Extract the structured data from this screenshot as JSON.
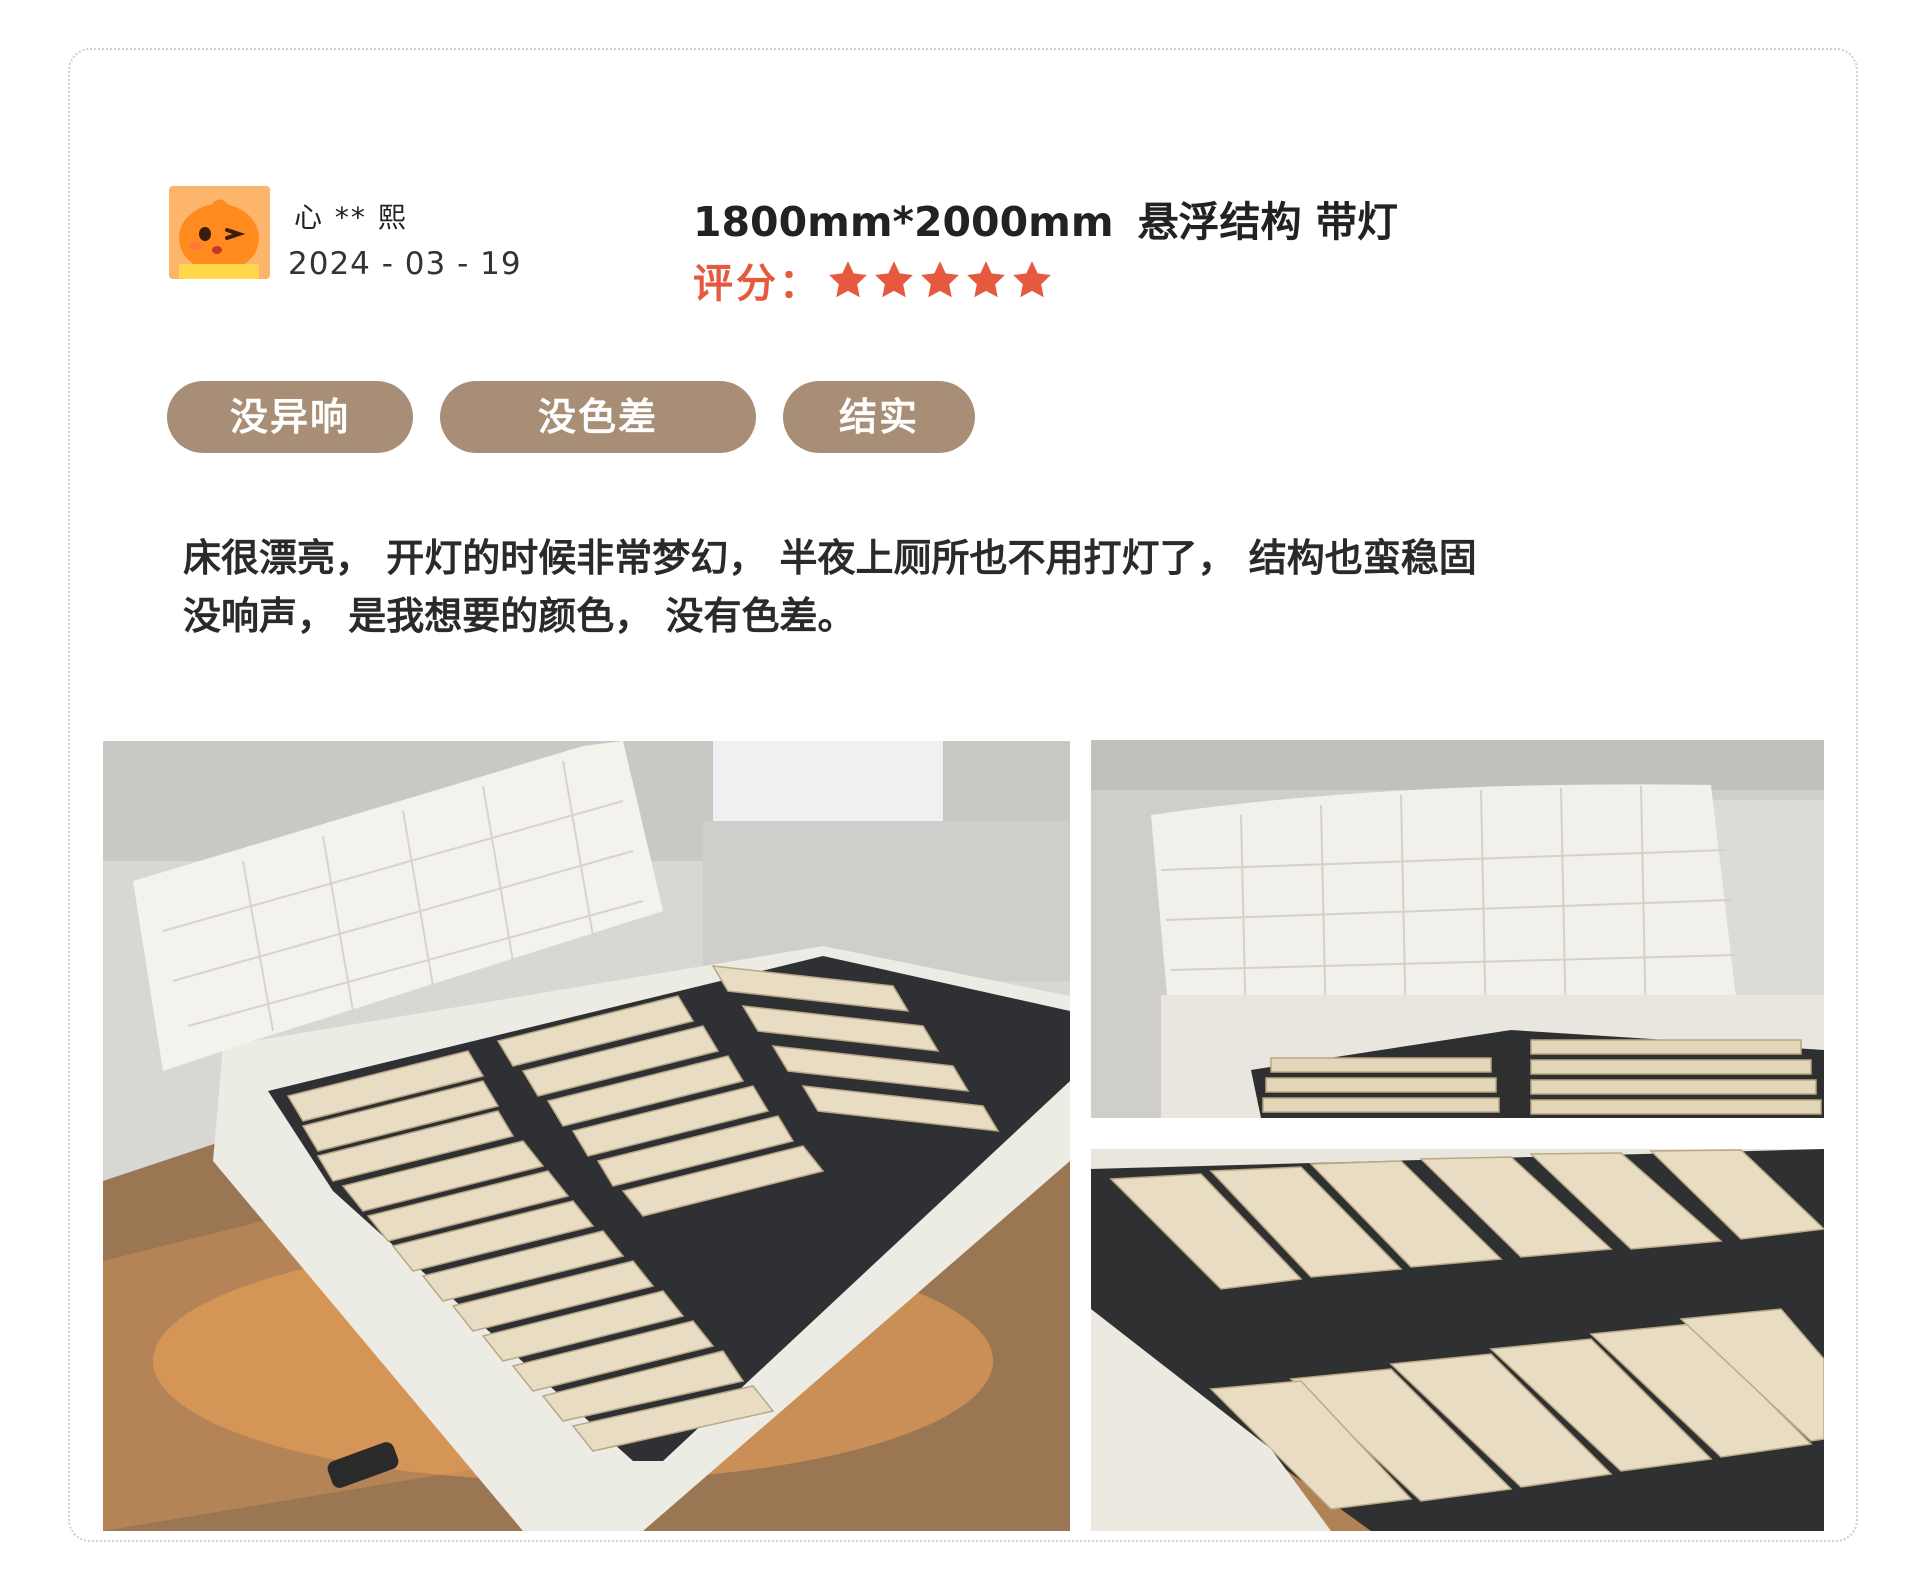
{
  "review": {
    "user_name": "心 ** 熙",
    "date": "2024 - 03 - 19",
    "spec_size": "1800mm*2000mm",
    "spec_options": "悬浮结构 带灯",
    "rating_label": "评分：",
    "rating": 5,
    "rating_max": 5,
    "star_color": "#e55a3e",
    "tags": [
      "没异响",
      "没色差",
      "结实"
    ],
    "tag_color": "#a88e77",
    "text_line1": "床很漂亮， 开灯的时候非常梦幻， 半夜上厕所也不用打灯了， 结构也蛮稳固",
    "text_line2": "没响声， 是我想要的颜色， 没有色差。"
  },
  "icons": {
    "avatar": "orange-mascot-avatar",
    "star": "star-icon"
  },
  "photos": [
    "bed-photo-main",
    "bed-photo-headboard",
    "bed-photo-slats"
  ]
}
